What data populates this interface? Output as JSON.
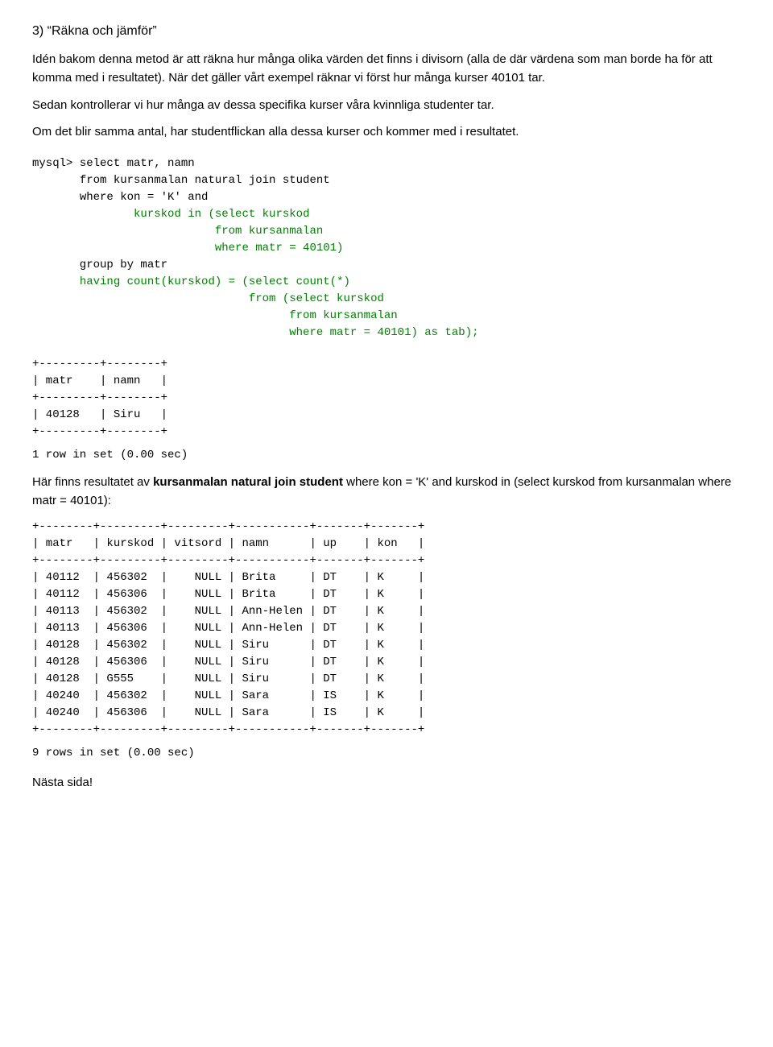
{
  "heading": "3) “Räkna och jämför”",
  "para1": "Idén bakom denna metod är att räkna hur många olika värden det finns i divisorn (alla de där värdena som man borde ha för att komma med i resultatet). När det gäller vårt exempel räknar vi först hur många kurser 40101 tar.",
  "para2": "Sedan kontrollerar vi hur många av dessa specifika kurser våra kvinnliga studenter tar.",
  "para3": "Om det blir samma antal, har studentflickan alla dessa kurser och kommer med i resultatet.",
  "code_prompt": "mysql>",
  "code_lines": [
    "mysql> select matr, namn",
    "       from kursanmalan natural join student",
    "       where kon = 'K' and",
    "               kurskod in (select kurskod",
    "                           from kursanmalan",
    "                           where matr = 40101)",
    "       group by matr",
    "       having count(kurskod) = (select count(*)",
    "                                from (select kurskod",
    "                                      from kursanmalan",
    "                                      where matr = 40101) as tab);"
  ],
  "result_table_small": [
    "+---------+--------+",
    "| matr    | namn   |",
    "+---------+--------+",
    "| 40128   | Siru   |",
    "+---------+--------+"
  ],
  "result_rows_small": "1 row in set (0.00 sec)",
  "explanation_prefix": "Här finns resultatet av",
  "explanation_bold": "kursanmalan natural join student",
  "explanation_suffix": "where kon = 'K' and kurskod in (select kurskod from kursanmalan where matr = 40101):",
  "big_table_lines": [
    "+--------+---------+---------+-----------+-------+-------+",
    "| matr   | kurskod | vitsord | namn      | up    | kon   |",
    "+--------+---------+---------+-----------+-------+-------+",
    "| 40112  | 456302  |    NULL | Brita     | DT    | K     |",
    "| 40112  | 456306  |    NULL | Brita     | DT    | K     |",
    "| 40113  | 456302  |    NULL | Ann-Helen | DT    | K     |",
    "| 40113  | 456306  |    NULL | Ann-Helen | DT    | K     |",
    "| 40128  | 456302  |    NULL | Siru      | DT    | K     |",
    "| 40128  | 456306  |    NULL | Siru      | DT    | K     |",
    "| 40128  | G555    |    NULL | Siru      | DT    | K     |",
    "| 40240  | 456302  |    NULL | Sara      | IS    | K     |",
    "| 40240  | 456306  |    NULL | Sara      | IS    | K     |",
    "+--------+---------+---------+-----------+-------+-------+"
  ],
  "big_table_rows": "9 rows in set (0.00 sec)",
  "footer": "Nästa sida!"
}
